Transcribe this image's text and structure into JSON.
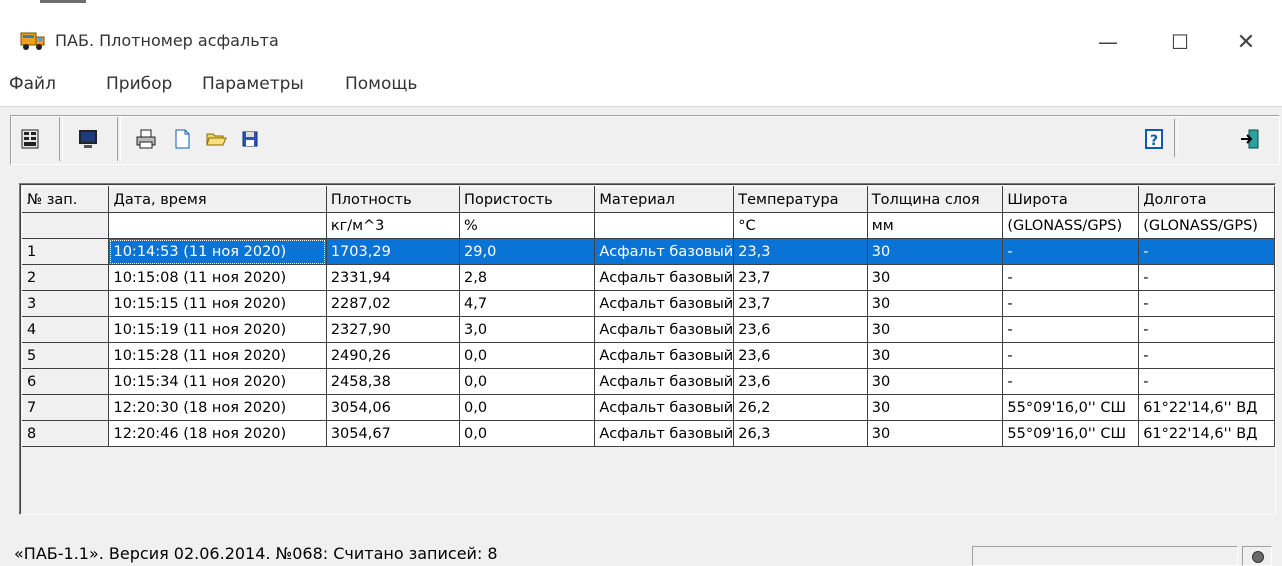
{
  "window": {
    "title": "ПАБ. Плотномер асфальта",
    "minimize": "—",
    "maximize": "☐",
    "close": "✕"
  },
  "menu": {
    "items": [
      "Файл",
      "Прибор",
      "Параметры",
      "Помощь"
    ]
  },
  "toolbar": {
    "buttons": [
      "device-icon",
      "monitor-icon",
      "printer-icon",
      "new-document-icon",
      "open-folder-icon",
      "save-disk-icon",
      "help-icon",
      "exit-icon"
    ]
  },
  "table": {
    "headers": [
      "№ зап.",
      "Дата, время",
      "Плотность",
      "Пористость",
      "Материал",
      "Температура",
      "Толщина слоя",
      "Широта",
      "Долгота"
    ],
    "units": [
      "",
      "",
      "кг/м^3",
      "%",
      "",
      "°C",
      "мм",
      "(GLONASS/GPS)",
      "(GLONASS/GPS)"
    ],
    "rows": [
      [
        "1",
        "10:14:53 (11 ноя 2020)",
        "1703,29",
        "29,0",
        "Асфальт базовый",
        "23,3",
        "30",
        "-",
        "-"
      ],
      [
        "2",
        "10:15:08 (11 ноя 2020)",
        "2331,94",
        "2,8",
        "Асфальт базовый",
        "23,7",
        "30",
        "-",
        "-"
      ],
      [
        "3",
        "10:15:15 (11 ноя 2020)",
        "2287,02",
        "4,7",
        "Асфальт базовый",
        "23,7",
        "30",
        "-",
        "-"
      ],
      [
        "4",
        "10:15:19 (11 ноя 2020)",
        "2327,90",
        "3,0",
        "Асфальт базовый",
        "23,6",
        "30",
        "-",
        "-"
      ],
      [
        "5",
        "10:15:28 (11 ноя 2020)",
        "2490,26",
        "0,0",
        "Асфальт базовый",
        "23,6",
        "30",
        "-",
        "-"
      ],
      [
        "6",
        "10:15:34 (11 ноя 2020)",
        "2458,38",
        "0,0",
        "Асфальт базовый",
        "23,6",
        "30",
        "-",
        "-"
      ],
      [
        "7",
        "12:20:30 (18 ноя 2020)",
        "3054,06",
        "0,0",
        "Асфальт базовый",
        "26,2",
        "30",
        "55°09'16,0'' СШ",
        "61°22'14,6'' ВД"
      ],
      [
        "8",
        "12:20:46 (18 ноя 2020)",
        "3054,67",
        "0,0",
        "Асфальт базовый",
        "26,3",
        "30",
        "55°09'16,0'' СШ",
        "61°22'14,6'' ВД"
      ]
    ],
    "selected_row": 0
  },
  "status": {
    "text": "«ПАБ-1.1». Версия 02.06.2014. №068: Считано записей: 8"
  },
  "colors": {
    "selection": "#0a74d6",
    "window_bg": "#f0f0f0"
  }
}
